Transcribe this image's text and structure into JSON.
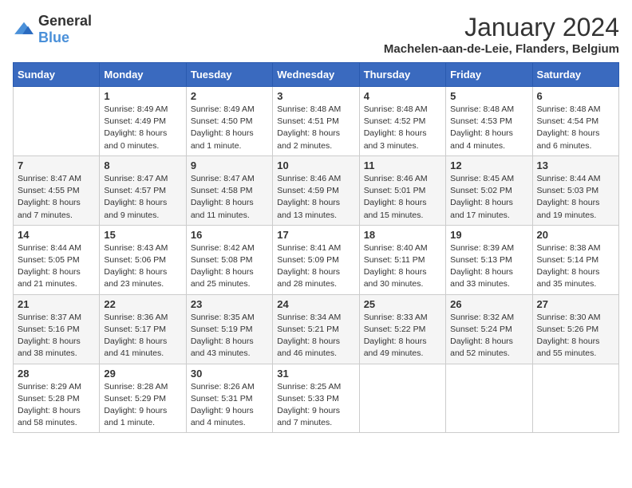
{
  "logo": {
    "text_general": "General",
    "text_blue": "Blue"
  },
  "header": {
    "title": "January 2024",
    "subtitle": "Machelen-aan-de-Leie, Flanders, Belgium"
  },
  "days_of_week": [
    "Sunday",
    "Monday",
    "Tuesday",
    "Wednesday",
    "Thursday",
    "Friday",
    "Saturday"
  ],
  "weeks": [
    [
      {
        "day": "",
        "sunrise": "",
        "sunset": "",
        "daylight": ""
      },
      {
        "day": "1",
        "sunrise": "Sunrise: 8:49 AM",
        "sunset": "Sunset: 4:49 PM",
        "daylight": "Daylight: 8 hours and 0 minutes."
      },
      {
        "day": "2",
        "sunrise": "Sunrise: 8:49 AM",
        "sunset": "Sunset: 4:50 PM",
        "daylight": "Daylight: 8 hours and 1 minute."
      },
      {
        "day": "3",
        "sunrise": "Sunrise: 8:48 AM",
        "sunset": "Sunset: 4:51 PM",
        "daylight": "Daylight: 8 hours and 2 minutes."
      },
      {
        "day": "4",
        "sunrise": "Sunrise: 8:48 AM",
        "sunset": "Sunset: 4:52 PM",
        "daylight": "Daylight: 8 hours and 3 minutes."
      },
      {
        "day": "5",
        "sunrise": "Sunrise: 8:48 AM",
        "sunset": "Sunset: 4:53 PM",
        "daylight": "Daylight: 8 hours and 4 minutes."
      },
      {
        "day": "6",
        "sunrise": "Sunrise: 8:48 AM",
        "sunset": "Sunset: 4:54 PM",
        "daylight": "Daylight: 8 hours and 6 minutes."
      }
    ],
    [
      {
        "day": "7",
        "sunrise": "Sunrise: 8:47 AM",
        "sunset": "Sunset: 4:55 PM",
        "daylight": "Daylight: 8 hours and 7 minutes."
      },
      {
        "day": "8",
        "sunrise": "Sunrise: 8:47 AM",
        "sunset": "Sunset: 4:57 PM",
        "daylight": "Daylight: 8 hours and 9 minutes."
      },
      {
        "day": "9",
        "sunrise": "Sunrise: 8:47 AM",
        "sunset": "Sunset: 4:58 PM",
        "daylight": "Daylight: 8 hours and 11 minutes."
      },
      {
        "day": "10",
        "sunrise": "Sunrise: 8:46 AM",
        "sunset": "Sunset: 4:59 PM",
        "daylight": "Daylight: 8 hours and 13 minutes."
      },
      {
        "day": "11",
        "sunrise": "Sunrise: 8:46 AM",
        "sunset": "Sunset: 5:01 PM",
        "daylight": "Daylight: 8 hours and 15 minutes."
      },
      {
        "day": "12",
        "sunrise": "Sunrise: 8:45 AM",
        "sunset": "Sunset: 5:02 PM",
        "daylight": "Daylight: 8 hours and 17 minutes."
      },
      {
        "day": "13",
        "sunrise": "Sunrise: 8:44 AM",
        "sunset": "Sunset: 5:03 PM",
        "daylight": "Daylight: 8 hours and 19 minutes."
      }
    ],
    [
      {
        "day": "14",
        "sunrise": "Sunrise: 8:44 AM",
        "sunset": "Sunset: 5:05 PM",
        "daylight": "Daylight: 8 hours and 21 minutes."
      },
      {
        "day": "15",
        "sunrise": "Sunrise: 8:43 AM",
        "sunset": "Sunset: 5:06 PM",
        "daylight": "Daylight: 8 hours and 23 minutes."
      },
      {
        "day": "16",
        "sunrise": "Sunrise: 8:42 AM",
        "sunset": "Sunset: 5:08 PM",
        "daylight": "Daylight: 8 hours and 25 minutes."
      },
      {
        "day": "17",
        "sunrise": "Sunrise: 8:41 AM",
        "sunset": "Sunset: 5:09 PM",
        "daylight": "Daylight: 8 hours and 28 minutes."
      },
      {
        "day": "18",
        "sunrise": "Sunrise: 8:40 AM",
        "sunset": "Sunset: 5:11 PM",
        "daylight": "Daylight: 8 hours and 30 minutes."
      },
      {
        "day": "19",
        "sunrise": "Sunrise: 8:39 AM",
        "sunset": "Sunset: 5:13 PM",
        "daylight": "Daylight: 8 hours and 33 minutes."
      },
      {
        "day": "20",
        "sunrise": "Sunrise: 8:38 AM",
        "sunset": "Sunset: 5:14 PM",
        "daylight": "Daylight: 8 hours and 35 minutes."
      }
    ],
    [
      {
        "day": "21",
        "sunrise": "Sunrise: 8:37 AM",
        "sunset": "Sunset: 5:16 PM",
        "daylight": "Daylight: 8 hours and 38 minutes."
      },
      {
        "day": "22",
        "sunrise": "Sunrise: 8:36 AM",
        "sunset": "Sunset: 5:17 PM",
        "daylight": "Daylight: 8 hours and 41 minutes."
      },
      {
        "day": "23",
        "sunrise": "Sunrise: 8:35 AM",
        "sunset": "Sunset: 5:19 PM",
        "daylight": "Daylight: 8 hours and 43 minutes."
      },
      {
        "day": "24",
        "sunrise": "Sunrise: 8:34 AM",
        "sunset": "Sunset: 5:21 PM",
        "daylight": "Daylight: 8 hours and 46 minutes."
      },
      {
        "day": "25",
        "sunrise": "Sunrise: 8:33 AM",
        "sunset": "Sunset: 5:22 PM",
        "daylight": "Daylight: 8 hours and 49 minutes."
      },
      {
        "day": "26",
        "sunrise": "Sunrise: 8:32 AM",
        "sunset": "Sunset: 5:24 PM",
        "daylight": "Daylight: 8 hours and 52 minutes."
      },
      {
        "day": "27",
        "sunrise": "Sunrise: 8:30 AM",
        "sunset": "Sunset: 5:26 PM",
        "daylight": "Daylight: 8 hours and 55 minutes."
      }
    ],
    [
      {
        "day": "28",
        "sunrise": "Sunrise: 8:29 AM",
        "sunset": "Sunset: 5:28 PM",
        "daylight": "Daylight: 8 hours and 58 minutes."
      },
      {
        "day": "29",
        "sunrise": "Sunrise: 8:28 AM",
        "sunset": "Sunset: 5:29 PM",
        "daylight": "Daylight: 9 hours and 1 minute."
      },
      {
        "day": "30",
        "sunrise": "Sunrise: 8:26 AM",
        "sunset": "Sunset: 5:31 PM",
        "daylight": "Daylight: 9 hours and 4 minutes."
      },
      {
        "day": "31",
        "sunrise": "Sunrise: 8:25 AM",
        "sunset": "Sunset: 5:33 PM",
        "daylight": "Daylight: 9 hours and 7 minutes."
      },
      {
        "day": "",
        "sunrise": "",
        "sunset": "",
        "daylight": ""
      },
      {
        "day": "",
        "sunrise": "",
        "sunset": "",
        "daylight": ""
      },
      {
        "day": "",
        "sunrise": "",
        "sunset": "",
        "daylight": ""
      }
    ]
  ]
}
